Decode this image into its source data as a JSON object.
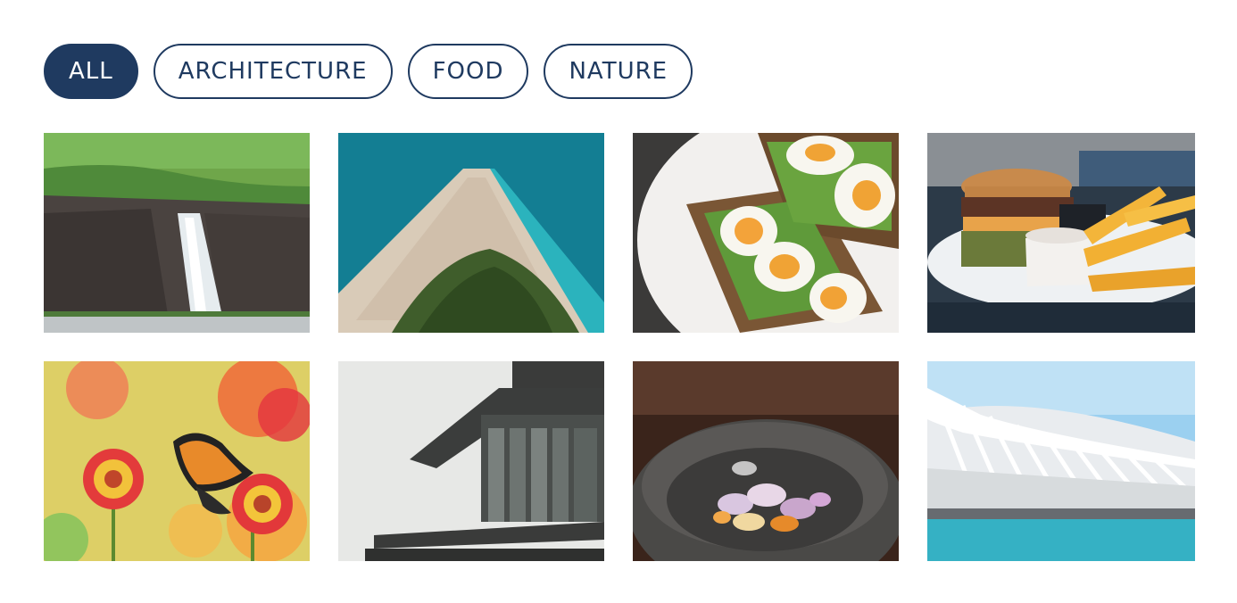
{
  "filters": [
    {
      "label": "ALL",
      "active": true
    },
    {
      "label": "ARCHITECTURE",
      "active": false
    },
    {
      "label": "FOOD",
      "active": false
    },
    {
      "label": "NATURE",
      "active": false
    }
  ],
  "gallery": [
    {
      "id": "waterfall",
      "category": "nature",
      "subject": "waterfall-cliff"
    },
    {
      "id": "beach",
      "category": "nature",
      "subject": "aerial-beach-spit"
    },
    {
      "id": "avocado-toast",
      "category": "food",
      "subject": "avocado-egg-toast"
    },
    {
      "id": "burger",
      "category": "food",
      "subject": "burger-and-fries"
    },
    {
      "id": "butterfly",
      "category": "nature",
      "subject": "butterfly-on-flowers"
    },
    {
      "id": "modern-building",
      "category": "architecture",
      "subject": "glass-building-balconies"
    },
    {
      "id": "mortar",
      "category": "food",
      "subject": "stone-mortar-with-onions"
    },
    {
      "id": "futuristic-structure",
      "category": "architecture",
      "subject": "white-ribbed-structure-over-water"
    }
  ]
}
